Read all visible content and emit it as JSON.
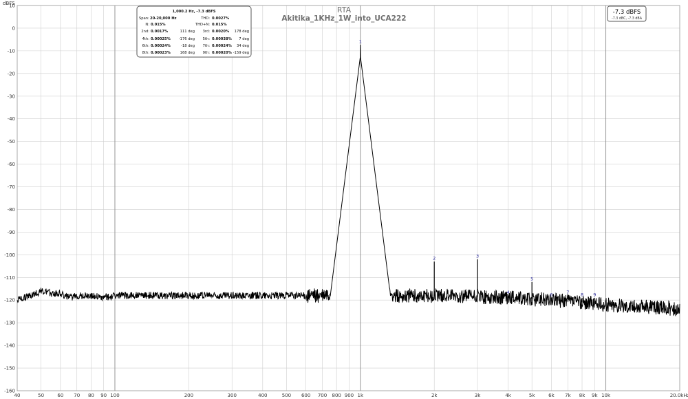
{
  "chart_data": {
    "type": "line",
    "title": "RTA",
    "subtitle": "Akitika_1KHz_1W_into_UCA222",
    "ylabel": "dBFS",
    "xscale": "log",
    "xlim": [
      40,
      20000
    ],
    "ylim": [
      -160,
      10
    ],
    "grid": true,
    "x_ticks": [
      {
        "v": 40,
        "label": "40"
      },
      {
        "v": 50,
        "label": "50"
      },
      {
        "v": 60,
        "label": "60"
      },
      {
        "v": 70,
        "label": "70"
      },
      {
        "v": 80,
        "label": "80"
      },
      {
        "v": 90,
        "label": "90"
      },
      {
        "v": 100,
        "label": "100"
      },
      {
        "v": 200,
        "label": "200"
      },
      {
        "v": 300,
        "label": "300"
      },
      {
        "v": 400,
        "label": "400"
      },
      {
        "v": 500,
        "label": "500"
      },
      {
        "v": 600,
        "label": "600"
      },
      {
        "v": 700,
        "label": "700"
      },
      {
        "v": 800,
        "label": "800"
      },
      {
        "v": 900,
        "label": "900"
      },
      {
        "v": 1000,
        "label": "1k"
      },
      {
        "v": 2000,
        "label": "2k"
      },
      {
        "v": 3000,
        "label": "3k"
      },
      {
        "v": 4000,
        "label": "4k"
      },
      {
        "v": 5000,
        "label": "5k"
      },
      {
        "v": 6000,
        "label": "6k"
      },
      {
        "v": 7000,
        "label": "7k"
      },
      {
        "v": 8000,
        "label": "8k"
      },
      {
        "v": 9000,
        "label": "9k"
      },
      {
        "v": 10000,
        "label": "10k"
      },
      {
        "v": 20000,
        "label": "20.0kHz"
      }
    ],
    "major_x": [
      100,
      1000,
      10000
    ],
    "y_ticks": [
      10,
      0,
      -10,
      -20,
      -30,
      -40,
      -50,
      -60,
      -70,
      -80,
      -90,
      -100,
      -110,
      -120,
      -130,
      -140,
      -150,
      -160
    ],
    "noise_floor": [
      [
        40,
        -120
      ],
      [
        45,
        -118
      ],
      [
        50,
        -116
      ],
      [
        55,
        -117
      ],
      [
        60,
        -117
      ],
      [
        65,
        -119
      ],
      [
        70,
        -118
      ],
      [
        80,
        -118
      ],
      [
        90,
        -119
      ],
      [
        100,
        -118
      ],
      [
        120,
        -118
      ],
      [
        150,
        -118
      ],
      [
        200,
        -118
      ],
      [
        300,
        -118
      ],
      [
        400,
        -118
      ],
      [
        500,
        -118
      ],
      [
        600,
        -118
      ],
      [
        700,
        -118
      ],
      [
        800,
        -117
      ],
      [
        900,
        -116
      ],
      [
        1200,
        -118
      ],
      [
        1500,
        -118
      ],
      [
        2000,
        -118
      ],
      [
        3000,
        -118.5
      ],
      [
        4000,
        -119
      ],
      [
        5000,
        -119.5
      ],
      [
        6000,
        -120
      ],
      [
        7000,
        -120.5
      ],
      [
        8000,
        -121
      ],
      [
        10000,
        -122
      ],
      [
        15000,
        -123
      ],
      [
        20000,
        -124
      ]
    ],
    "fundamental": {
      "freq": 1000,
      "level": -7.3
    },
    "harmonics": [
      {
        "n": "1",
        "freq": 1000,
        "level": -7.3
      },
      {
        "n": "2",
        "freq": 2000,
        "level": -103
      },
      {
        "n": "3",
        "freq": 3000,
        "level": -102
      },
      {
        "n": "4",
        "freq": 4000,
        "level": -118
      },
      {
        "n": "5",
        "freq": 5000,
        "level": -112
      },
      {
        "n": "6",
        "freq": 6000,
        "level": -119
      },
      {
        "n": "7",
        "freq": 7000,
        "level": -118
      },
      {
        "n": "8",
        "freq": 8000,
        "level": -119
      },
      {
        "n": "9",
        "freq": 9000,
        "level": -119
      }
    ],
    "colors": {
      "trace": "#000000",
      "grid": "#cfcfcf",
      "grid_major": "#8a8a8a",
      "marker": "#2b2b9a"
    }
  },
  "stats_box": {
    "header": "1,000.2 Hz, -7.3 dBFS",
    "span_label": "Span:",
    "span_value": "20-20,000 Hz",
    "thd_label": "THD:",
    "thd_value": "0.0027%",
    "n_label": "N:",
    "n_value": "0.015%",
    "thdn_label": "THD+N:",
    "thdn_value": "0.015%",
    "rows": [
      {
        "l1": "2nd:",
        "v1": "0.0017%",
        "d1": "111 deg",
        "l2": "3rd:",
        "v2": "0.0020%",
        "d2": "178 deg"
      },
      {
        "l1": "4th:",
        "v1": "0.00025%",
        "d1": "-176 deg",
        "l2": "5th:",
        "v2": "0.00038%",
        "d2": "7 deg"
      },
      {
        "l1": "6th:",
        "v1": "0.00024%",
        "d1": "-18 deg",
        "l2": "7th:",
        "v2": "0.00024%",
        "d2": "34 deg"
      },
      {
        "l1": "8th:",
        "v1": "0.00023%",
        "d1": "168 deg",
        "l2": "9th:",
        "v2": "0.00020%",
        "d2": "-159 deg"
      }
    ]
  },
  "level_box": {
    "main": "-7.3 dBFS",
    "sub": "-7.3 dBC, -7.3 dBA"
  }
}
